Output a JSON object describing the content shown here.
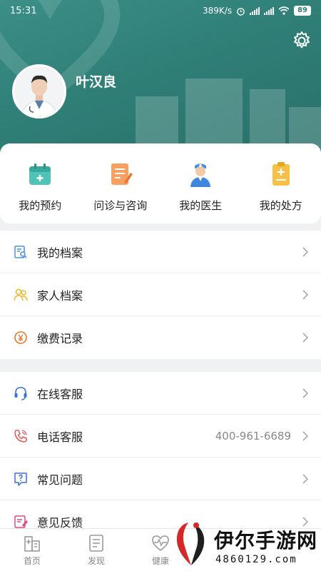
{
  "status_bar": {
    "time": "15:31",
    "net_speed": "389K/s",
    "battery": "89"
  },
  "profile": {
    "name": "叶汉良"
  },
  "quick_actions": [
    {
      "label": "我的预约",
      "icon": "calendar-icon"
    },
    {
      "label": "问诊与咨询",
      "icon": "consultation-icon"
    },
    {
      "label": "我的医生",
      "icon": "doctor-icon"
    },
    {
      "label": "我的处方",
      "icon": "prescription-icon"
    }
  ],
  "records": [
    {
      "label": "我的档案",
      "icon": "record-search-icon"
    },
    {
      "label": "家人档案",
      "icon": "family-icon"
    },
    {
      "label": "缴费记录",
      "icon": "payment-icon"
    }
  ],
  "services": [
    {
      "label": "在线客服",
      "icon": "headset-icon"
    },
    {
      "label": "电话客服",
      "icon": "phone-icon",
      "extra": "400-961-6689"
    },
    {
      "label": "常见问题",
      "icon": "question-icon"
    },
    {
      "label": "意见反馈",
      "icon": "feedback-icon"
    }
  ],
  "tabs": [
    {
      "label": "首页",
      "icon": "hospital-icon"
    },
    {
      "label": "发现",
      "icon": "document-icon"
    },
    {
      "label": "健康",
      "icon": "heartbeat-icon"
    }
  ],
  "watermark": {
    "name": "伊尔手游网",
    "url": "4860129.com"
  },
  "colors": {
    "header": "#2f7f77",
    "accent_teal": "#3fbfb0",
    "accent_orange": "#f08a3c",
    "accent_blue": "#4a90e2",
    "accent_yellow": "#f5b82e"
  }
}
